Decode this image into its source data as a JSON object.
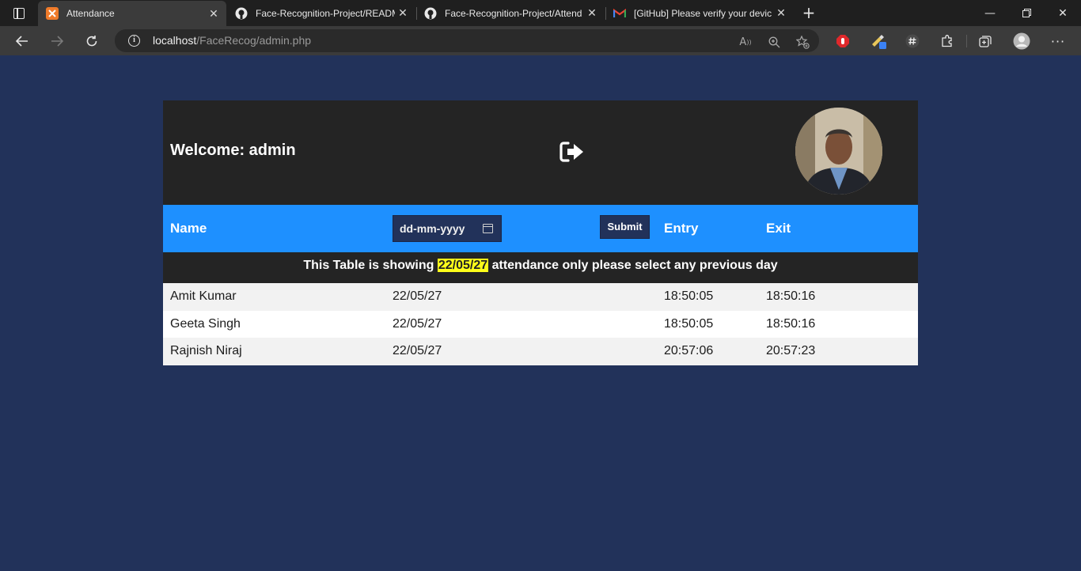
{
  "browser": {
    "tabs": [
      {
        "title": "Attendance",
        "active": true
      },
      {
        "title": "Face-Recognition-Project/READM",
        "active": false
      },
      {
        "title": "Face-Recognition-Project/Attend",
        "active": false
      },
      {
        "title": "[GitHub] Please verify your devic",
        "active": false
      }
    ],
    "address": {
      "host": "localhost",
      "path": "/FaceRecog/admin.php"
    }
  },
  "header": {
    "welcome": "Welcome: admin"
  },
  "filter": {
    "name_label": "Name",
    "date_placeholder": "dd-mm-yyyy",
    "submit_label": "Submit",
    "entry_label": "Entry",
    "exit_label": "Exit"
  },
  "notice": {
    "prefix": "This Table is showing",
    "date": "22/05/27",
    "suffix": "attendance only please select any previous day"
  },
  "rows": [
    {
      "name": "Amit Kumar",
      "date": "22/05/27",
      "entry": "18:50:05",
      "exit": "18:50:16"
    },
    {
      "name": "Geeta Singh",
      "date": "22/05/27",
      "entry": "18:50:05",
      "exit": "18:50:16"
    },
    {
      "name": "Rajnish Niraj",
      "date": "22/05/27",
      "entry": "20:57:06",
      "exit": "20:57:23"
    }
  ]
}
